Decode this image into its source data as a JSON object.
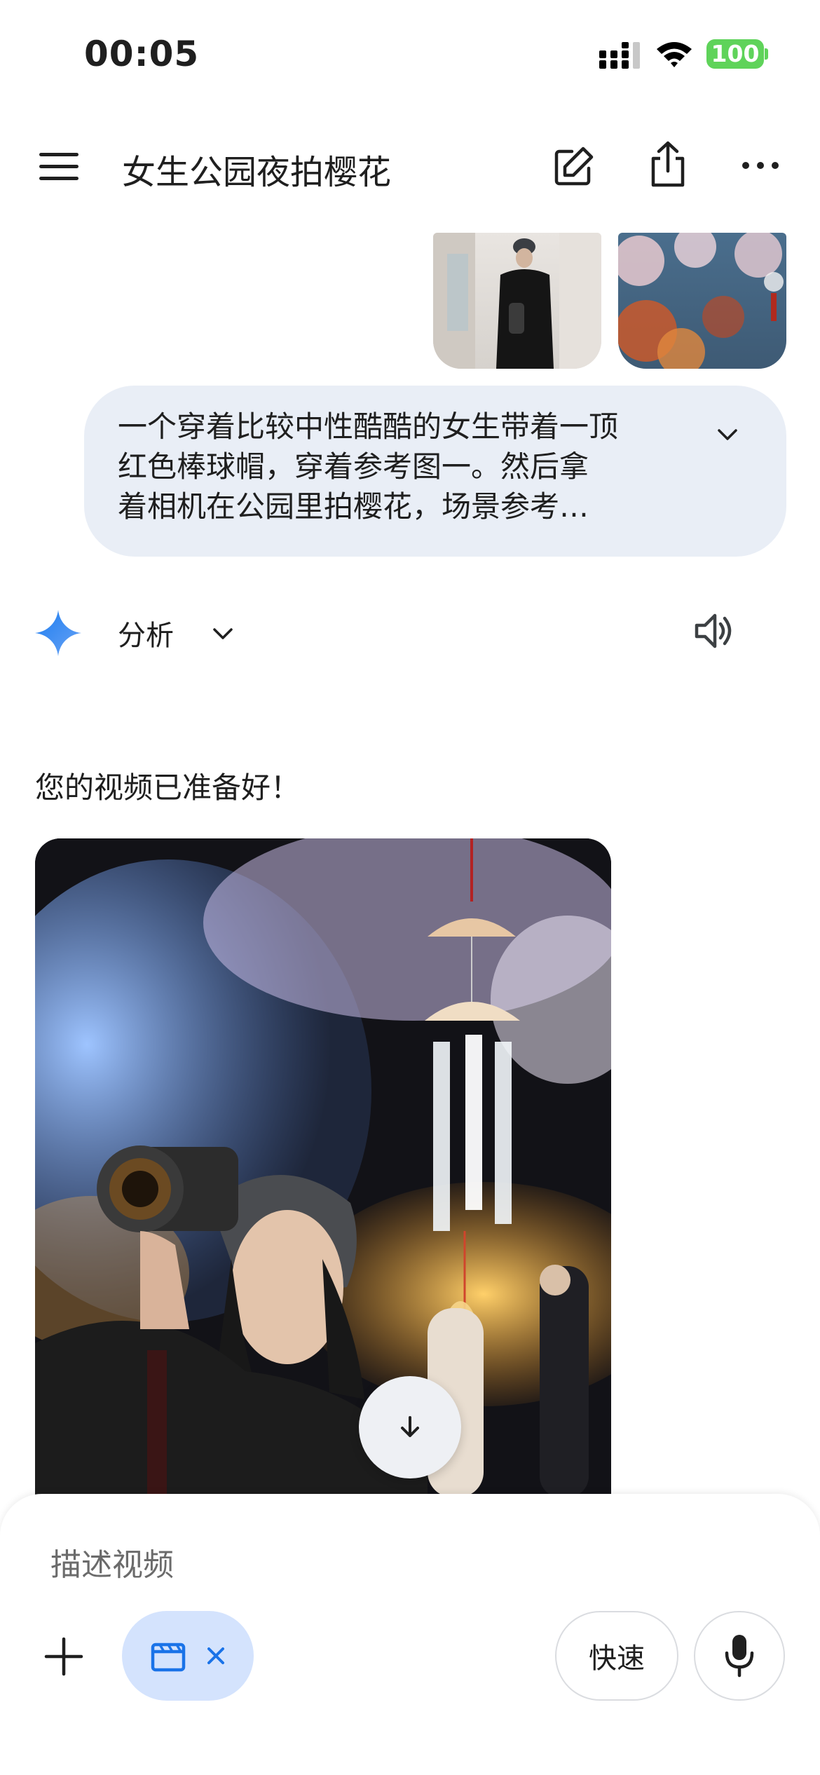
{
  "status_bar": {
    "time": "00:05",
    "battery": "100"
  },
  "header": {
    "title": "女生公园夜拍樱花"
  },
  "attachments": [
    {
      "name": "reference-image-1"
    },
    {
      "name": "reference-image-2"
    }
  ],
  "user_message": {
    "text": "一个穿着比较中性酷酷的女生带着一顶\n红色棒球帽，穿着参考图一。然后拿\n着相机在公园里拍樱花，场景参考…"
  },
  "model": {
    "analysis_label": "分析"
  },
  "response": {
    "text": "您的视频已准备好！"
  },
  "composer": {
    "placeholder": "描述视频",
    "fast_label": "快速"
  },
  "colors": {
    "accent": "#1a73e8",
    "chip_bg": "#d4e3fd",
    "bubble_bg": "#e9eef6",
    "battery": "#5fd35a"
  }
}
